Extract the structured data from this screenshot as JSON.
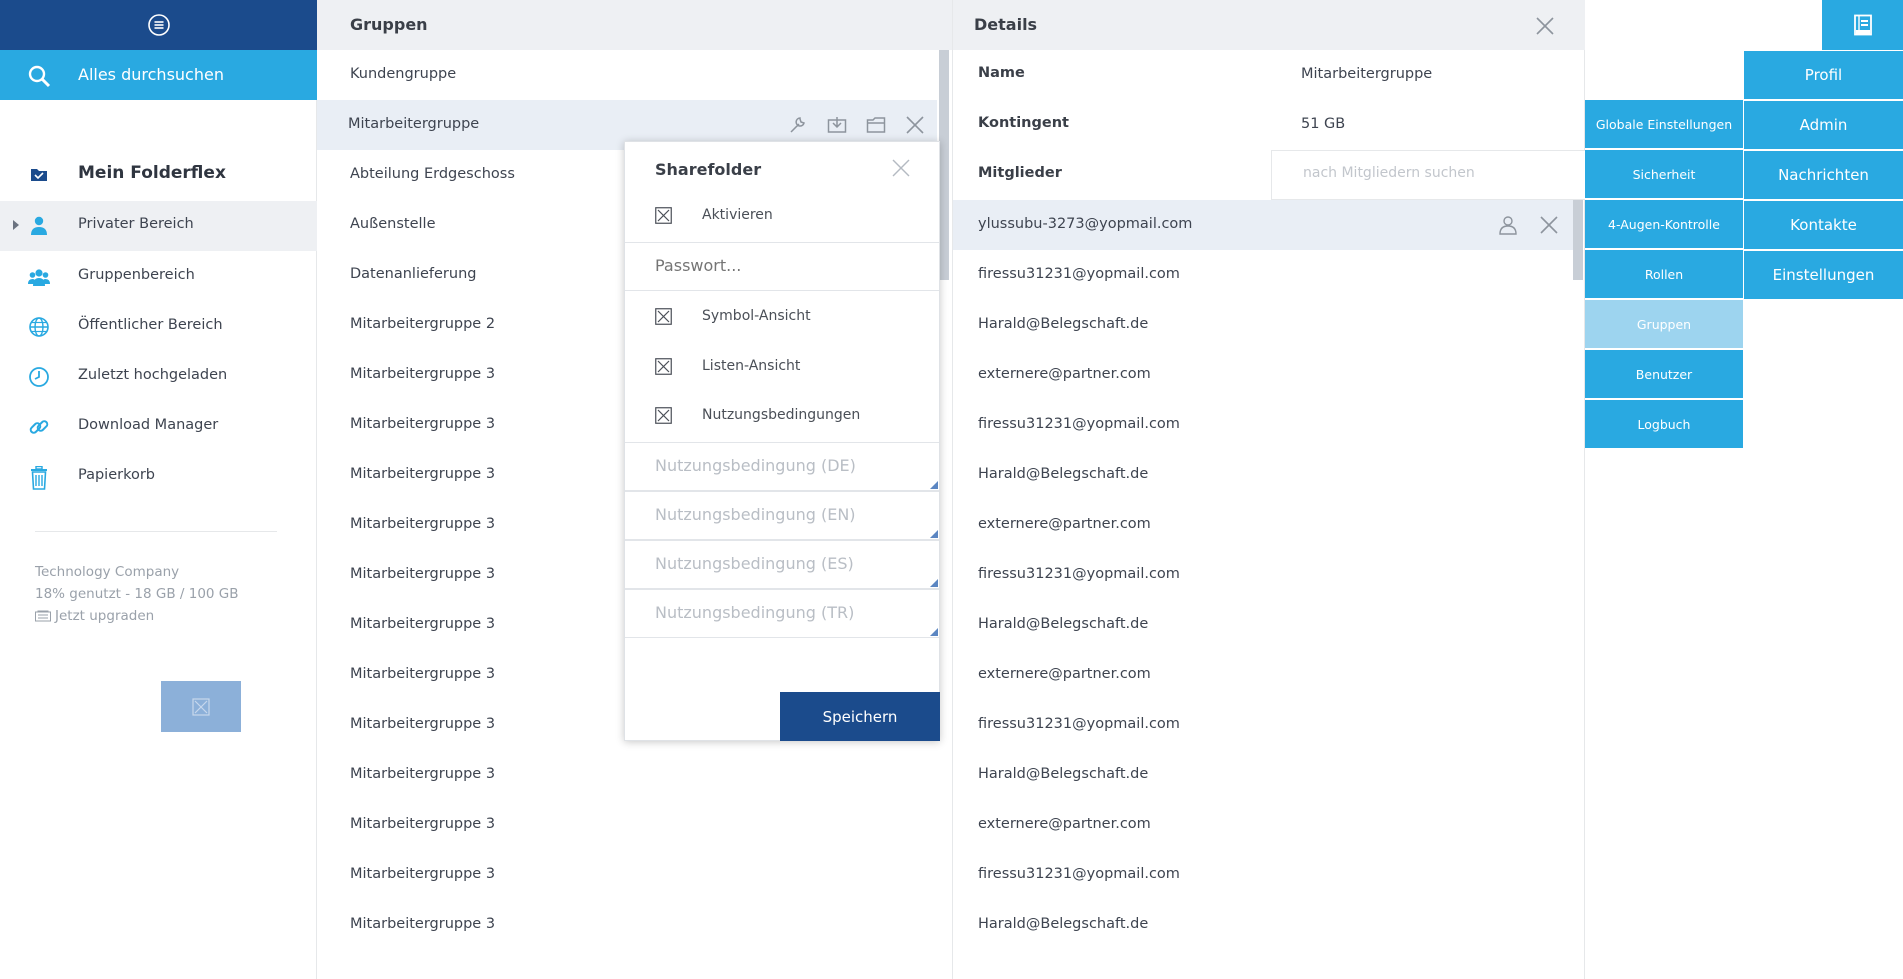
{
  "sidebar": {
    "search_label": "Alles durchsuchen",
    "brand_label": "Mein Folderflex",
    "items": [
      {
        "label": "Privater Bereich",
        "icon": "person-icon"
      },
      {
        "label": "Gruppenbereich",
        "icon": "group-icon"
      },
      {
        "label": "Öffentlicher Bereich",
        "icon": "globe-icon"
      },
      {
        "label": "Zuletzt hochgeladen",
        "icon": "clock-icon"
      },
      {
        "label": "Download Manager",
        "icon": "link-icon"
      },
      {
        "label": "Papierkorb",
        "icon": "trash-icon"
      }
    ],
    "company": "Technology Company",
    "usage": "18% genutzt - 18 GB / 100 GB",
    "upgrade": "Jetzt upgraden"
  },
  "groups": {
    "title": "Gruppen",
    "items": [
      "Kundengruppe",
      "Mitarbeitergruppe",
      "Abteilung Erdgeschoss",
      "Außenstelle",
      "Datenanlieferung",
      "Mitarbeitergruppe 2",
      "Mitarbeitergruppe 3",
      "Mitarbeitergruppe 3",
      "Mitarbeitergruppe 3",
      "Mitarbeitergruppe 3",
      "Mitarbeitergruppe 3",
      "Mitarbeitergruppe 3",
      "Mitarbeitergruppe 3",
      "Mitarbeitergruppe 3",
      "Mitarbeitergruppe 3",
      "Mitarbeitergruppe 3",
      "Mitarbeitergruppe 3",
      "Mitarbeitergruppe 3"
    ]
  },
  "sharefolder": {
    "title": "Sharefolder",
    "activate_label": "Aktivieren",
    "password_placeholder": "Passwort...",
    "symbol_view_label": "Symbol-Ansicht",
    "list_view_label": "Listen-Ansicht",
    "terms_label": "Nutzungsbedingungen",
    "terms_de_placeholder": "Nutzungsbedingung (DE)",
    "terms_en_placeholder": "Nutzungsbedingung (EN)",
    "terms_es_placeholder": "Nutzungsbedingung (ES)",
    "terms_tr_placeholder": "Nutzungsbedingung (TR)",
    "save_label": "Speichern"
  },
  "details": {
    "title": "Details",
    "name_label": "Name",
    "name_value": "Mitarbeitergruppe",
    "quota_label": "Kontingent",
    "quota_value": "51 GB",
    "members_label": "Mitglieder",
    "members_search_placeholder": "nach Mitgliedern suchen",
    "members": [
      "ylussubu-3273@yopmail.com",
      "firessu31231@yopmail.com",
      "Harald@Belegschaft.de",
      "externere@partner.com",
      "firessu31231@yopmail.com",
      "Harald@Belegschaft.de",
      "externere@partner.com",
      "firessu31231@yopmail.com",
      "Harald@Belegschaft.de",
      "externere@partner.com",
      "firessu31231@yopmail.com",
      "Harald@Belegschaft.de",
      "externere@partner.com",
      "firessu31231@yopmail.com",
      "Harald@Belegschaft.de"
    ]
  },
  "admin_menu": {
    "left": [
      "Globale Einstellungen",
      "Sicherheit",
      "4-Augen-Kontrolle",
      "Rollen",
      "Gruppen",
      "Benutzer",
      "Logbuch"
    ],
    "right": [
      "Profil",
      "Admin",
      "Nachrichten",
      "Kontakte",
      "Einstellungen"
    ],
    "selected": "Gruppen"
  },
  "colors": {
    "navy": "#1b4b8c",
    "accent": "#29a9e1",
    "accent_selected": "#9dd4ef"
  }
}
